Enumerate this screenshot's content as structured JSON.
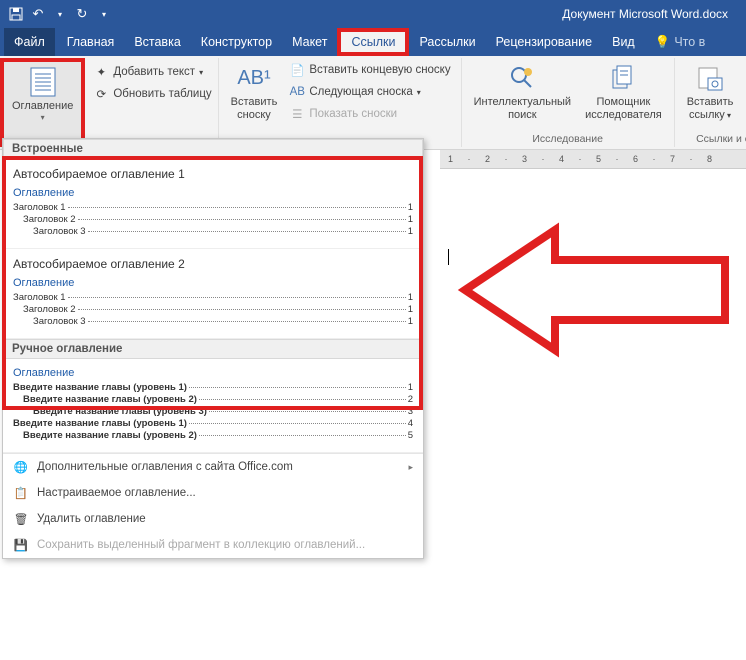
{
  "titlebar": {
    "doc_title": "Документ Microsoft Word.docx"
  },
  "menu": {
    "file": "Файл",
    "home": "Главная",
    "insert": "Вставка",
    "design": "Конструктор",
    "layout": "Макет",
    "references": "Ссылки",
    "mailings": "Рассылки",
    "review": "Рецензирование",
    "view": "Вид",
    "tell_me": "Что в"
  },
  "ribbon": {
    "toc": {
      "label": "Оглавление"
    },
    "add_text": "Добавить текст",
    "update_table": "Обновить таблицу",
    "insert_footnote": {
      "label1": "Вставить",
      "label2": "сноску"
    },
    "insert_endnote": "Вставить концевую сноску",
    "next_footnote": "Следующая сноска",
    "show_notes": "Показать сноски",
    "smart_lookup": {
      "label1": "Интеллектуальный",
      "label2": "поиск"
    },
    "researcher": {
      "label1": "Помощник",
      "label2": "исследователя"
    },
    "research_group": "Исследование",
    "insert_link": {
      "label1": "Вставить",
      "label2": "ссылку"
    },
    "links_group": "Ссылки и с"
  },
  "ruler_text": "1 · 2 · 3 · 4 · 5 · 6 · 7 · 8",
  "dropdown": {
    "builtin": "Встроенные",
    "manual": "Ручное оглавление",
    "auto1": {
      "title": "Автособираемое оглавление 1",
      "heading": "Оглавление",
      "lines": [
        {
          "t": "Заголовок 1",
          "p": "1",
          "lvl": 1
        },
        {
          "t": "Заголовок 2",
          "p": "1",
          "lvl": 2
        },
        {
          "t": "Заголовок 3",
          "p": "1",
          "lvl": 3
        }
      ]
    },
    "auto2": {
      "title": "Автособираемое оглавление 2",
      "heading": "Оглавление",
      "lines": [
        {
          "t": "Заголовок 1",
          "p": "1",
          "lvl": 1
        },
        {
          "t": "Заголовок 2",
          "p": "1",
          "lvl": 2
        },
        {
          "t": "Заголовок 3",
          "p": "1",
          "lvl": 3
        }
      ]
    },
    "manual_item": {
      "heading": "Оглавление",
      "lines": [
        {
          "t": "Введите название главы (уровень 1)",
          "p": "1",
          "lvl": 1,
          "b": true
        },
        {
          "t": "Введите название главы (уровень 2)",
          "p": "2",
          "lvl": 2,
          "b": true
        },
        {
          "t": "Введите название главы (уровень 3)",
          "p": "3",
          "lvl": 3,
          "b": true
        },
        {
          "t": "Введите название главы (уровень 1)",
          "p": "4",
          "lvl": 1,
          "b": true
        },
        {
          "t": "Введите название главы (уровень 2)",
          "p": "5",
          "lvl": 2,
          "b": true
        }
      ]
    },
    "more_office": "Дополнительные оглавления с сайта Office.com",
    "custom": "Настраиваемое оглавление...",
    "remove": "Удалить оглавление",
    "save_sel": "Сохранить выделенный фрагмент в коллекцию оглавлений..."
  }
}
